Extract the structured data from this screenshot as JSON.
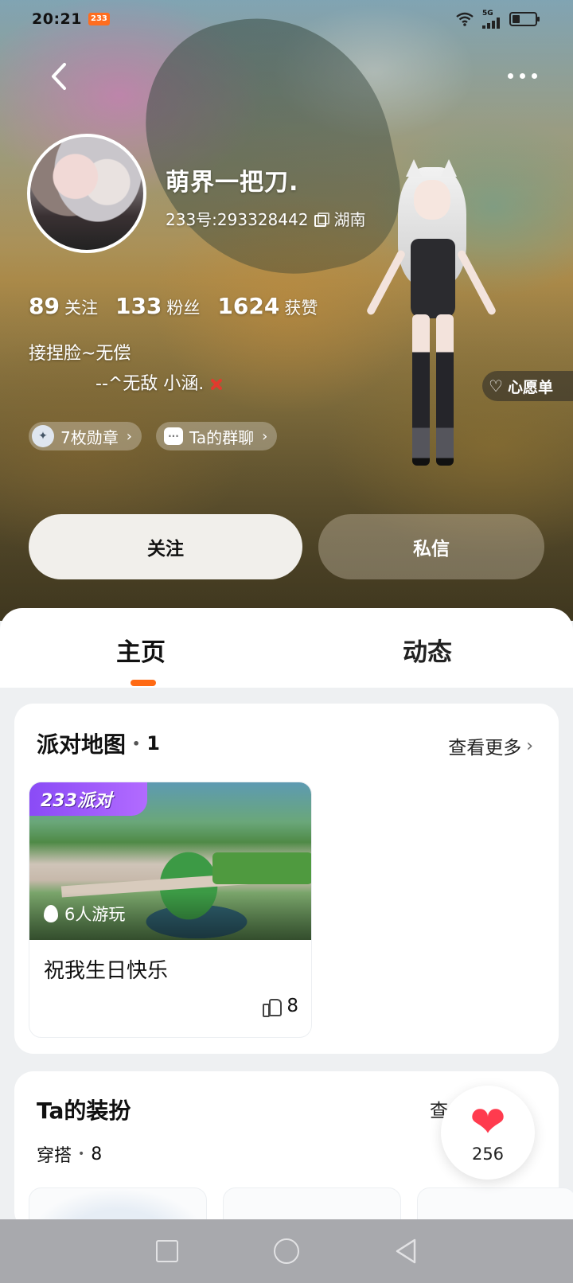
{
  "status_bar": {
    "time": "20:21",
    "app_badge": "233",
    "network_label": "5G",
    "icons": [
      "wifi-icon",
      "signal-icon",
      "battery-icon"
    ]
  },
  "profile": {
    "username": "萌界一把刀.",
    "uid_label": "233号:",
    "uid": "293328442",
    "location": "湖南",
    "stats": [
      {
        "value": "89",
        "label": "关注"
      },
      {
        "value": "133",
        "label": "粉丝"
      },
      {
        "value": "1624",
        "label": "获赞"
      }
    ],
    "bio_line1": "接捏脸~无偿",
    "bio_line2": "--^无敌 小涵.",
    "chips": {
      "badges": "7枚勋章",
      "group_chat": "Ta的群聊"
    },
    "wishlist": "心愿单",
    "follow_button": "关注",
    "message_button": "私信"
  },
  "tabs": {
    "home": "主页",
    "feed": "动态",
    "active": "home"
  },
  "party_map": {
    "title": "派对地图",
    "count": "1",
    "see_more": "查看更多",
    "items": [
      {
        "brand": "233派对",
        "players": "6人游玩",
        "name": "祝我生日快乐",
        "likes": "8"
      }
    ]
  },
  "outfit": {
    "title": "Ta的装扮",
    "see_more_partial": "查",
    "subtitle": "穿搭",
    "count": "8"
  },
  "floating_like": {
    "count": "256"
  },
  "colors": {
    "accent_orange": "#ff6a14",
    "brand_purple": "#8a4bf6",
    "heart_red": "#ff3b4e",
    "nav_gray": "#a8a9ad"
  }
}
